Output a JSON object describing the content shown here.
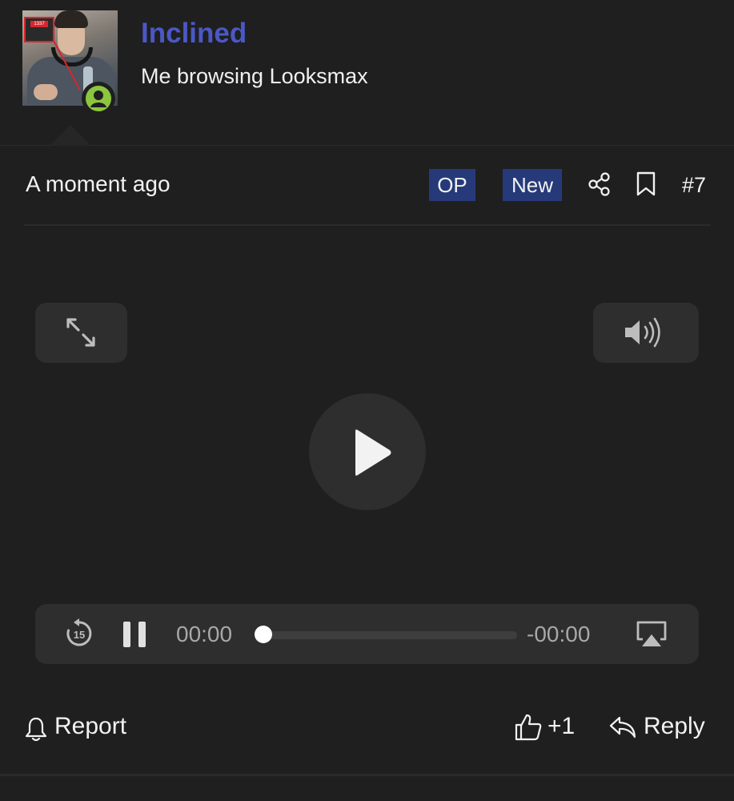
{
  "post": {
    "username": "Inclined",
    "user_title": "Me browsing Looksmax",
    "avatar_badge": "1337",
    "timestamp": "A moment ago",
    "tags": {
      "op": "OP",
      "new": "New"
    },
    "post_number": "#7"
  },
  "video": {
    "time_elapsed": "00:00",
    "time_remaining": "-00:00",
    "progress": 0,
    "skip_back_seconds": "15"
  },
  "actions": {
    "report_label": "Report",
    "like_label": "+1",
    "reply_label": "Reply"
  },
  "colors": {
    "background": "#1f1f1f",
    "username": "#4a58c6",
    "tag_bg": "#263a7a",
    "online": "#8cc63f",
    "control_bg": "#2e2e2e"
  },
  "icons": [
    "user-icon",
    "share-icon",
    "bookmark-icon",
    "expand-icon",
    "volume-icon",
    "play-icon",
    "skip-back-15-icon",
    "pause-icon",
    "airplay-icon",
    "bell-icon",
    "thumbs-up-icon",
    "reply-icon"
  ]
}
